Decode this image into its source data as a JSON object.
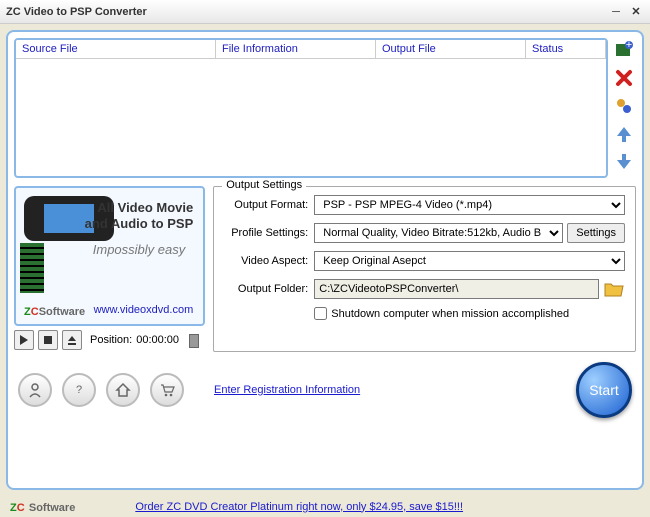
{
  "window": {
    "title": "ZC Video to PSP Converter"
  },
  "columns": {
    "source": "Source File",
    "info": "File Information",
    "output": "Output File",
    "status": "Status"
  },
  "promo": {
    "line1": "All Video Movie",
    "line2": "and Audio to PSP",
    "line3": "Impossibly easy",
    "brand_z": "Z",
    "brand_c": "C",
    "brand_rest": "Software",
    "url": "www.videoxdvd.com"
  },
  "player": {
    "position_label": "Position:",
    "position_value": "00:00:00"
  },
  "settings": {
    "legend": "Output Settings",
    "format_label": "Output Format:",
    "format_value": "PSP - PSP MPEG-4 Video (*.mp4)",
    "profile_label": "Profile Settings:",
    "profile_value": "Normal Quality, Video Bitrate:512kb, Audio B",
    "settings_btn": "Settings",
    "aspect_label": "Video Aspect:",
    "aspect_value": "Keep Original Asepct",
    "folder_label": "Output Folder:",
    "folder_value": "C:\\ZCVideotoPSPConverter\\",
    "shutdown": "Shutdown computer when mission accomplished"
  },
  "links": {
    "register": "Enter Registration Information",
    "order": "Order ZC DVD Creator Platinum right now, only $24.95, save $15!!!"
  },
  "start": "Start"
}
